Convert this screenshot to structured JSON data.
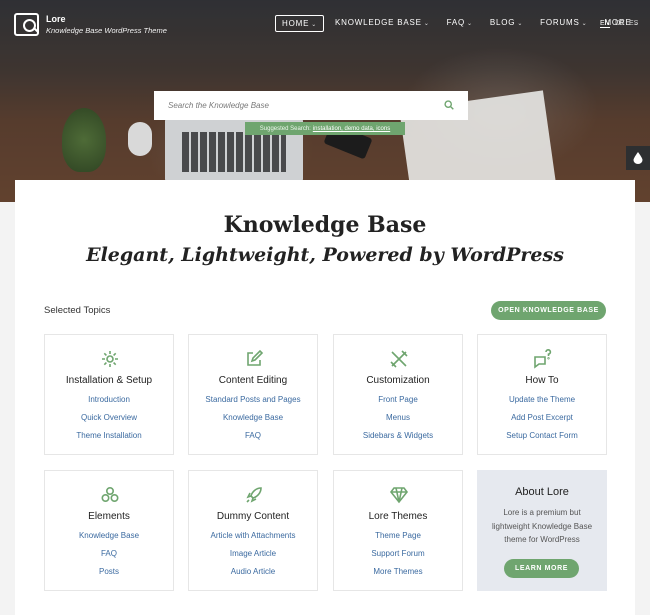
{
  "site": {
    "name": "Lore",
    "tagline": "Knowledge Base WordPress Theme"
  },
  "nav": [
    {
      "label": "HOME",
      "active": true
    },
    {
      "label": "KNOWLEDGE BASE"
    },
    {
      "label": "FAQ"
    },
    {
      "label": "BLOG"
    },
    {
      "label": "FORUMS"
    },
    {
      "label": "MORE"
    }
  ],
  "languages": [
    "EN",
    "DE",
    "ES"
  ],
  "search": {
    "placeholder": "Search the Knowledge Base",
    "suggest_prefix": "Suggested Search:",
    "suggest_links": "installation, demo data, icons"
  },
  "main": {
    "title": "Knowledge Base",
    "subtitle": "Elegant, Lightweight, Powered by WordPress",
    "section_label": "Selected Topics",
    "open_button": "OPEN KNOWLEDGE BASE"
  },
  "topics": [
    {
      "title": "Installation & Setup",
      "icon": "settings-icon",
      "links": [
        "Introduction",
        "Quick Overview",
        "Theme Installation"
      ]
    },
    {
      "title": "Content Editing",
      "icon": "edit-icon",
      "links": [
        "Standard Posts and Pages",
        "Knowledge Base",
        "FAQ"
      ]
    },
    {
      "title": "Customization",
      "icon": "tools-icon",
      "links": [
        "Front Page",
        "Menus",
        "Sidebars & Widgets"
      ]
    },
    {
      "title": "How To",
      "icon": "question-chat-icon",
      "links": [
        "Update the Theme",
        "Add Post Excerpt",
        "Setup Contact Form"
      ]
    },
    {
      "title": "Elements",
      "icon": "blocks-icon",
      "links": [
        "Knowledge Base",
        "FAQ",
        "Posts"
      ]
    },
    {
      "title": "Dummy Content",
      "icon": "rocket-icon",
      "links": [
        "Article with Attachments",
        "Image Article",
        "Audio Article"
      ]
    },
    {
      "title": "Lore Themes",
      "icon": "diamond-icon",
      "links": [
        "Theme Page",
        "Support Forum",
        "More Themes"
      ]
    }
  ],
  "about": {
    "title": "About Lore",
    "text": "Lore is a premium but lightweight Knowledge Base theme for WordPress",
    "button": "LEARN MORE"
  },
  "colors": {
    "accent": "#6fa56f",
    "link": "#3b6aa0",
    "about_bg": "#e6e9ef"
  }
}
